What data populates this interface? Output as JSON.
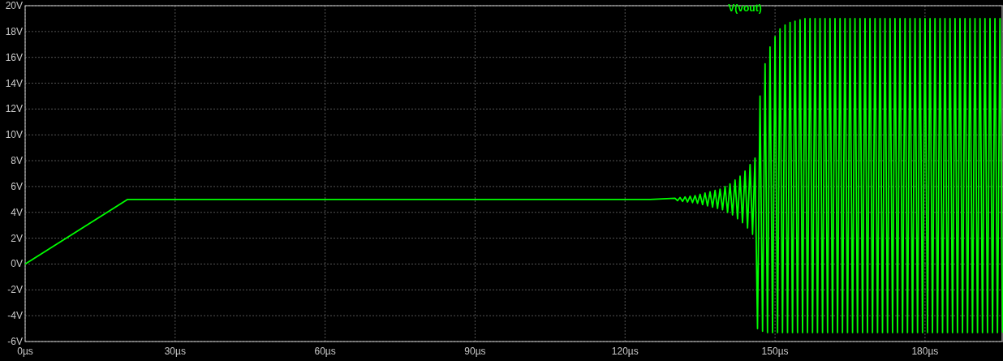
{
  "plot": {
    "chart_data": {
      "type": "line",
      "grid": true,
      "x": [
        0,
        20.5,
        125,
        130,
        130.5,
        131,
        131.5,
        132,
        132.5,
        133,
        133.5,
        134,
        134.5,
        135,
        135.5,
        136,
        136.5,
        137,
        137.5,
        138,
        138.5,
        139,
        139.5,
        140,
        140.5,
        141,
        141.5,
        142,
        142.5,
        143,
        143.5,
        144,
        144.5,
        145,
        145.5,
        146,
        146.5,
        147,
        147.5,
        148,
        148.5,
        149,
        149.5,
        150,
        150.5,
        151,
        151.5,
        152,
        152.5,
        153,
        153.5,
        154,
        154.5,
        155,
        155.5,
        156,
        156.5,
        157,
        157.5,
        158,
        158.5,
        159,
        159.5,
        160,
        160.5,
        161,
        161.5,
        162,
        162.5,
        163,
        163.5,
        164,
        164.5,
        165,
        165.5,
        166,
        166.5,
        167,
        167.5,
        168,
        168.5,
        169,
        169.5,
        170,
        170.5,
        171,
        171.5,
        172,
        172.5,
        173,
        173.5,
        174,
        174.5,
        175,
        175.5,
        176,
        176.5,
        177,
        177.5,
        178,
        178.5,
        179,
        179.5,
        180,
        180.5,
        181,
        181.5,
        182,
        182.5,
        183,
        183.5,
        184,
        184.5,
        185,
        185.5,
        186,
        186.5,
        187,
        187.5,
        188,
        188.5,
        189,
        189.5,
        190,
        190.5,
        191,
        191.5,
        192,
        192.5,
        193,
        193.5,
        194,
        194.5,
        195,
        195.5
      ],
      "series": [
        {
          "name": "V(vout)",
          "color": "#00ff00",
          "values": [
            0,
            5,
            5,
            5.1,
            4.9,
            5.15,
            4.85,
            5.2,
            4.8,
            5.25,
            4.75,
            5.3,
            4.7,
            5.4,
            4.6,
            5.5,
            4.5,
            5.6,
            4.4,
            5.7,
            4.3,
            5.8,
            4.2,
            6,
            4,
            6.2,
            3.8,
            6.5,
            3.5,
            6.8,
            3.2,
            7.2,
            2.8,
            7.7,
            2.3,
            8.2,
            -5,
            13,
            -5.2,
            15.5,
            -5.3,
            16.8,
            -5.3,
            17.6,
            -5.3,
            18.2,
            -5.3,
            18.5,
            -5.3,
            18.7,
            -5.3,
            18.8,
            -5.3,
            18.9,
            -5.3,
            19,
            -5.3,
            19,
            -5.3,
            19,
            -5.3,
            19,
            -5.3,
            19,
            -5.3,
            19,
            -5.3,
            19,
            -5.3,
            19,
            -5.3,
            19,
            -5.3,
            19,
            -5.3,
            19,
            -5.3,
            19,
            -5.3,
            19,
            -5.3,
            19,
            -5.3,
            19,
            -5.3,
            19,
            -5.3,
            19,
            -5.3,
            19,
            -5.3,
            19,
            -5.3,
            19,
            -5.3,
            19,
            -5.3,
            19,
            -5.3,
            19,
            -5.3,
            19,
            -5.3,
            19,
            -5.3,
            19,
            -5.3,
            19,
            -5.3,
            19,
            -5.3,
            19,
            -5.3,
            19,
            -5.3,
            19,
            -5.3,
            19,
            -5.3,
            19,
            -5.3,
            19,
            -5.3,
            19,
            -5.3,
            19,
            -5.3,
            19,
            -5.3,
            19,
            -5.3,
            19,
            -5.3,
            19,
            -5.3
          ]
        }
      ],
      "xlim": [
        0,
        195.6
      ],
      "ylim": [
        -6,
        20
      ],
      "xticks": [
        {
          "value": 0,
          "label": "0µs"
        },
        {
          "value": 30,
          "label": "30µs"
        },
        {
          "value": 60,
          "label": "60µs"
        },
        {
          "value": 90,
          "label": "90µs"
        },
        {
          "value": 120,
          "label": "120µs"
        },
        {
          "value": 150,
          "label": "150µs"
        },
        {
          "value": 180,
          "label": "180µs"
        }
      ],
      "yticks": [
        {
          "value": 20,
          "label": "20V"
        },
        {
          "value": 18,
          "label": "18V"
        },
        {
          "value": 16,
          "label": "16V"
        },
        {
          "value": 14,
          "label": "14V"
        },
        {
          "value": 12,
          "label": "12V"
        },
        {
          "value": 10,
          "label": "10V"
        },
        {
          "value": 8,
          "label": "8V"
        },
        {
          "value": 6,
          "label": "6V"
        },
        {
          "value": 4,
          "label": "4V"
        },
        {
          "value": 2,
          "label": "2V"
        },
        {
          "value": 0,
          "label": "0V"
        },
        {
          "value": -2,
          "label": "-2V"
        },
        {
          "value": -4,
          "label": "-4V"
        },
        {
          "value": -6,
          "label": "-6V"
        }
      ]
    }
  }
}
